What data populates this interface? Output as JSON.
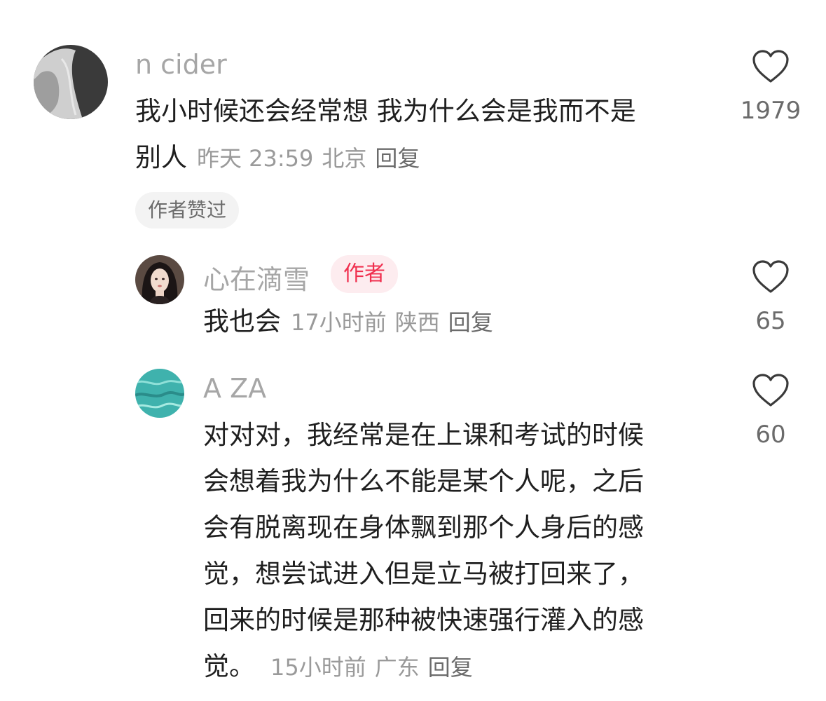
{
  "comments": [
    {
      "username": "n cider",
      "text_lines": [
        "我小时候还会经常想 我为什么会是我而不是",
        "别人"
      ],
      "time": "昨天 23:59",
      "location": "北京",
      "reply_label": "回复",
      "likes": "1979",
      "author_liked_label": "作者赞过",
      "avatar_icon": "grayscale-photo-avatar"
    },
    {
      "username": "心在滴雪",
      "badge": "作者",
      "text": "我也会",
      "time": "17小时前",
      "location": "陕西",
      "reply_label": "回复",
      "likes": "65",
      "avatar_icon": "woman-portrait-avatar"
    },
    {
      "username": "A ZA",
      "text_lines": [
        "对对对，我经常是在上课和考试的时候",
        "会想着我为什么不能是某个人呢，之后",
        "会有脱离现在身体飘到那个人身后的感",
        "觉，想尝试进入但是立马被打回来了，",
        "回来的时候是那种被快速强行灌入的感",
        "觉。"
      ],
      "time": "15小时前",
      "location": "广东",
      "reply_label": "回复",
      "likes": "60",
      "avatar_icon": "sea-water-avatar"
    }
  ],
  "colors": {
    "accent_red": "#f0304f",
    "muted_text": "#9a9a9a",
    "main_text": "#1f1f1f"
  }
}
